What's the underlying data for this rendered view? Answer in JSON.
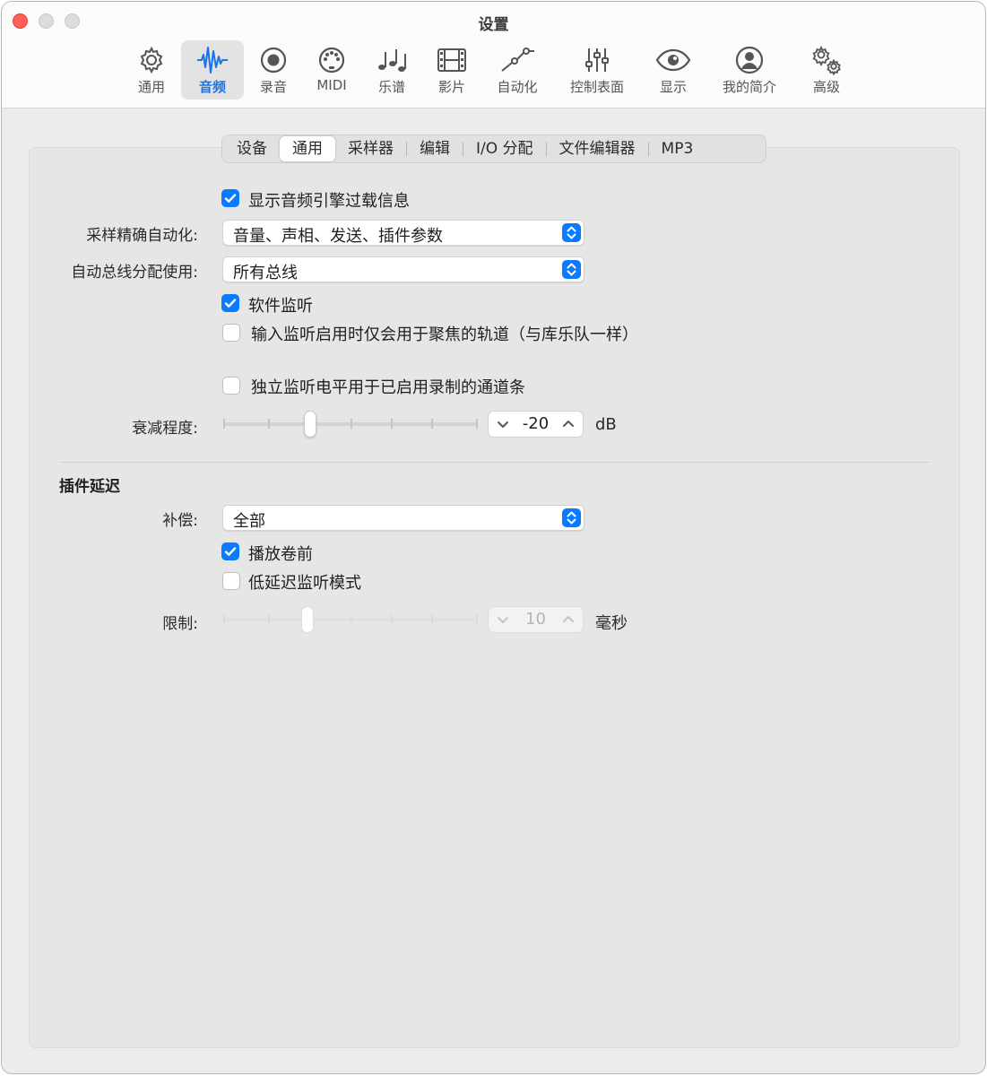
{
  "window": {
    "title": "设置"
  },
  "toolbar": {
    "items": [
      {
        "label": "通用",
        "icon": "gear-icon"
      },
      {
        "label": "音频",
        "icon": "waveform-icon",
        "active": true
      },
      {
        "label": "录音",
        "icon": "record-icon"
      },
      {
        "label": "MIDI",
        "icon": "midi-port-icon"
      },
      {
        "label": "乐谱",
        "icon": "music-notes-icon"
      },
      {
        "label": "影片",
        "icon": "film-icon"
      },
      {
        "label": "自动化",
        "icon": "automation-curve-icon"
      },
      {
        "label": "控制表面",
        "icon": "faders-icon"
      },
      {
        "label": "显示",
        "icon": "eye-icon"
      },
      {
        "label": "我的简介",
        "icon": "person-icon"
      },
      {
        "label": "高级",
        "icon": "gears-icon"
      }
    ]
  },
  "tabs": {
    "selected": "通用",
    "items": [
      "设备",
      "通用",
      "采样器",
      "编辑",
      "I/O 分配",
      "文件编辑器",
      "MP3"
    ]
  },
  "general": {
    "show_overload": {
      "label": "显示音频引擎过载信息",
      "checked": true
    },
    "sample_accurate_automation": {
      "label": "采样精确自动化:",
      "value": "音量、声相、发送、插件参数"
    },
    "auto_bus_assignment": {
      "label": "自动总线分配使用:",
      "value": "所有总线"
    },
    "software_monitoring": {
      "label": "软件监听",
      "checked": true
    },
    "input_monitoring_focused": {
      "label": "输入监听启用时仅会用于聚焦的轨道（与库乐队一样）",
      "checked": false
    },
    "independent_monitoring_level": {
      "label": "独立监听电平用于已启用录制的通道条",
      "checked": false
    },
    "dim_level": {
      "label": "衰减程度:",
      "value": "-20",
      "unit": "dB",
      "slider_fraction": 0.34
    }
  },
  "plugin_latency": {
    "title": "插件延迟",
    "compensation": {
      "label": "补偿:",
      "value": "全部"
    },
    "playback_preroll": {
      "label": "播放卷前",
      "checked": true
    },
    "low_latency_mode": {
      "label": "低延迟监听模式",
      "checked": false
    },
    "limit": {
      "label": "限制:",
      "value": "10",
      "unit": "毫秒",
      "slider_fraction": 0.33,
      "enabled": false
    }
  },
  "colors": {
    "accent": "#0a7aff",
    "close": "#fe5f57"
  }
}
